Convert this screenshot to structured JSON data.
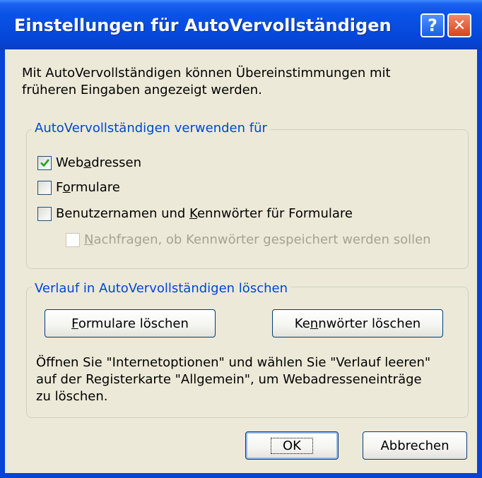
{
  "window": {
    "title": "Einstellungen für AutoVervollständigen",
    "help_glyph": "?",
    "close_glyph": "✕"
  },
  "intro": {
    "line1": "Mit AutoVervollständigen können Übereinstimmungen mit",
    "line2": "früheren Eingaben angezeigt werden."
  },
  "use_group": {
    "legend": "AutoVervollständigen verwenden für",
    "options": [
      {
        "pre": "Web",
        "ul": "a",
        "post": "dressen",
        "checked": true,
        "enabled": true
      },
      {
        "pre": "F",
        "ul": "o",
        "post": "rmulare",
        "checked": false,
        "enabled": true
      },
      {
        "pre": "Benutzernamen und ",
        "ul": "K",
        "post": "ennwörter für Formulare",
        "checked": false,
        "enabled": true
      },
      {
        "pre": "",
        "ul": "N",
        "post": "achfragen, ob Kennwörter gespeichert werden sollen",
        "checked": false,
        "enabled": false
      }
    ]
  },
  "history_group": {
    "legend": "Verlauf in AutoVervollständigen löschen",
    "btn_forms": {
      "pre": "",
      "ul": "F",
      "post": "ormulare löschen"
    },
    "btn_passwords": {
      "pre": "Ke",
      "ul": "n",
      "post": "nwörter löschen"
    },
    "note": [
      "Öffnen Sie \"Internetoptionen\" und wählen Sie \"Verlauf leeren\"",
      "auf der Registerkarte \"Allgemein\", um Webadresseneinträge",
      "zu löschen."
    ]
  },
  "footer": {
    "ok": "OK",
    "cancel": "Abbrechen"
  },
  "colors": {
    "titlebar": "#0a52e6",
    "client": "#ece9d8",
    "legend_text": "#0046d5",
    "checkmark": "#21a121",
    "disabled_text": "#a4a292"
  }
}
